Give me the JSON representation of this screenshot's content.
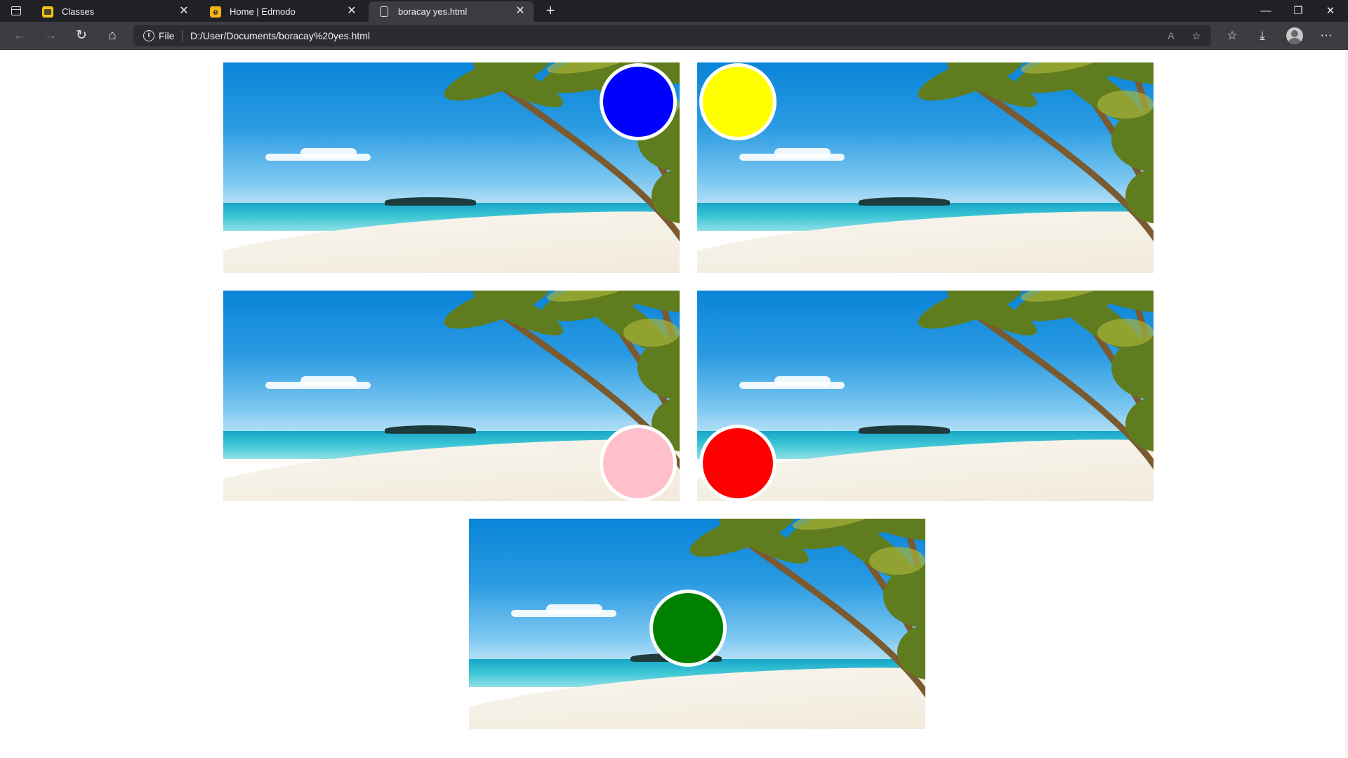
{
  "tabs": [
    {
      "label": "Classes",
      "icon": "classes-favicon-icon",
      "active": false
    },
    {
      "label": "Home | Edmodo",
      "icon": "edmodo-favicon-icon",
      "active": false
    },
    {
      "label": "boracay yes.html",
      "icon": "page-favicon-icon",
      "active": true
    }
  ],
  "edmodo_favicon_letter": "e",
  "address_bar": {
    "scheme_label": "File",
    "url": "D:/User/Documents/boracay%20yes.html"
  },
  "page": {
    "images": [
      {
        "name": "beach-image-1",
        "dot_color": "#0000ff",
        "dot_position": "top-right"
      },
      {
        "name": "beach-image-2",
        "dot_color": "#ffff00",
        "dot_position": "top-left"
      },
      {
        "name": "beach-image-3",
        "dot_color": "#ffc0cb",
        "dot_position": "bottom-right"
      },
      {
        "name": "beach-image-4",
        "dot_color": "#ff0000",
        "dot_position": "bottom-left"
      },
      {
        "name": "beach-image-5",
        "dot_color": "#008000",
        "dot_position": "center"
      }
    ]
  },
  "colors": {
    "titlebar": "#202124",
    "toolbar": "#3b3d42",
    "omnibox": "#2b2c30"
  }
}
